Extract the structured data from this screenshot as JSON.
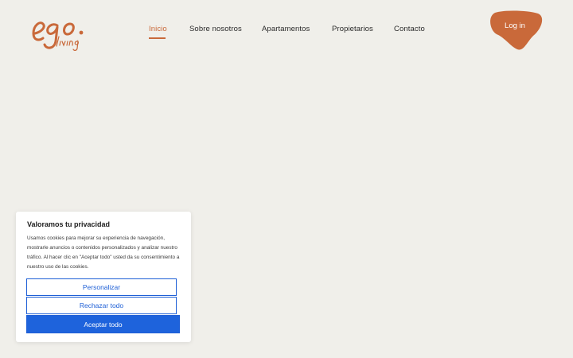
{
  "header": {
    "logo": {
      "main_text": "ego.",
      "sub_text": "living",
      "color": "#c9693a"
    },
    "nav": [
      {
        "label": "Inicio",
        "active": true
      },
      {
        "label": "Sobre nosotros",
        "active": false
      },
      {
        "label": "Apartamentos",
        "active": false
      },
      {
        "label": "Propietarios",
        "active": false
      },
      {
        "label": "Contacto",
        "active": false
      }
    ],
    "login": {
      "label": "Log in",
      "color": "#c9693a"
    }
  },
  "cookie_banner": {
    "title": "Valoramos tu privacidad",
    "body": "Usamos cookies para mejorar su experiencia de navegación, mostrarle anuncios o contenidos personalizados y analizar nuestro tráfico. Al hacer clic en \"Aceptar todo\" usted da su consentimiento a nuestro uso de las cookies.",
    "buttons": {
      "customize": "Personalizar",
      "reject": "Rechazar todo",
      "accept": "Aceptar todo"
    },
    "accent_color": "#1e63dc"
  }
}
